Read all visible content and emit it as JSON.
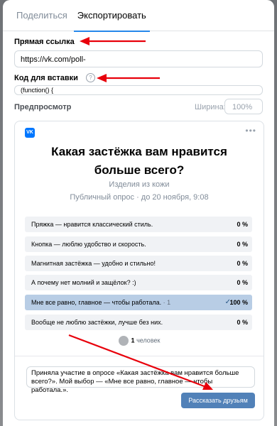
{
  "tabs": [
    {
      "label": "Поделиться"
    },
    {
      "label": "Экспортировать"
    }
  ],
  "direct_link": {
    "label": "Прямая ссылка",
    "value": "https://vk.com/poll-"
  },
  "embed_code": {
    "label": "Код для вставки",
    "help": "?",
    "value": "(function() {"
  },
  "preview": {
    "label": "Предпросмотр",
    "width_label": "Ширина:",
    "width_value": "100%"
  },
  "poll": {
    "logo": "VK",
    "more": "•••",
    "title": "Какая застёжка вам нравится больше всего?",
    "group": "Изделия из кожи",
    "meta": "Публичный опрос · до 20 ноября, 9:08",
    "options": [
      {
        "text": "Пряжка — нравится классический стиль.",
        "percent": "0 %"
      },
      {
        "text": "Кнопка — люблю удобство и скорость.",
        "percent": "0 %"
      },
      {
        "text": "Магнитная застёжка — удобно и стильно!",
        "percent": "0 %"
      },
      {
        "text": "А почему нет молний и защёлок? :)",
        "percent": "0 %"
      },
      {
        "text": "Мне все равно, главное — чтобы работала.",
        "count": " · 1",
        "check": "✓",
        "percent": "100 %",
        "selected": true
      },
      {
        "text": "Вообще не люблю застёжки, лучше без них.",
        "percent": "0 %"
      }
    ],
    "voters_count": "1",
    "voters_label": " человек"
  },
  "share": {
    "text": "Приняла участие в опросе «Какая застёжка вам нравится больше всего?». Мой выбор — «Мне все равно, главное — чтобы работала.».",
    "button": "Рассказать друзьям"
  },
  "colors": {
    "annotation_arrow": "#e8000b",
    "accent": "#2688eb",
    "button": "#5181b8",
    "selected_option": "#b8cde5"
  }
}
